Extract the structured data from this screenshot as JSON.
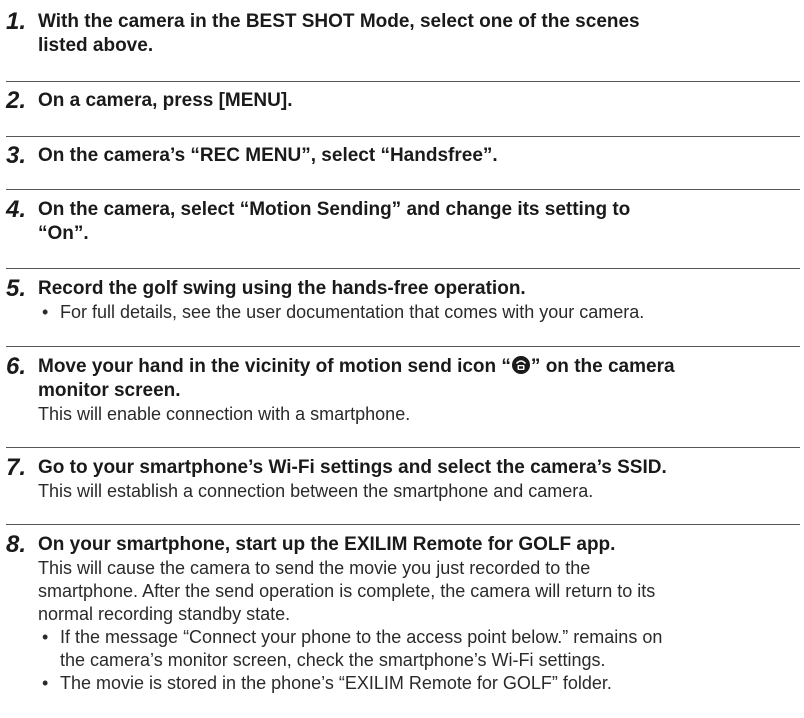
{
  "steps": [
    {
      "number": "1.",
      "heading_line1": "With the camera in the BEST SHOT Mode, select one of the scenes",
      "heading_line2": "listed above."
    },
    {
      "number": "2.",
      "heading_line1": "On a camera, press [MENU]."
    },
    {
      "number": "3.",
      "heading_line1": "On the camera’s “REC MENU”, select “Handsfree”."
    },
    {
      "number": "4.",
      "heading_line1": "On the camera, select “Motion Sending” and change its setting to",
      "heading_line2": "“On”."
    },
    {
      "number": "5.",
      "heading_line1": "Record the golf swing using the hands-free operation.",
      "bullets": [
        "For full details, see the user documentation that comes with your camera."
      ]
    },
    {
      "number": "6.",
      "heading_line1_before_icon": "Move your hand in the vicinity of motion send icon “",
      "heading_line1_after_icon": "” on the camera",
      "heading_line2": "monitor screen.",
      "body": [
        "This will enable connection with a smartphone."
      ],
      "icon": "motion-send-icon"
    },
    {
      "number": "7.",
      "heading_line1": "Go to your smartphone’s Wi-Fi settings and select the camera’s SSID.",
      "body": [
        "This will establish a connection between the smartphone and camera."
      ]
    },
    {
      "number": "8.",
      "heading_line1": "On your smartphone, start up the EXILIM Remote for GOLF app.",
      "body": [
        "This will cause the camera to send the movie you just recorded to the",
        "smartphone. After the send operation is complete, the camera will return to its",
        "normal recording standby state."
      ],
      "bullets": [
        [
          "If the message “Connect your phone to the access point below.” remains on",
          "the camera’s monitor screen, check the smartphone’s Wi-Fi settings."
        ],
        [
          "The movie is stored in the phone’s “EXILIM Remote for GOLF” folder."
        ]
      ]
    }
  ],
  "bullet_glyph": "•"
}
